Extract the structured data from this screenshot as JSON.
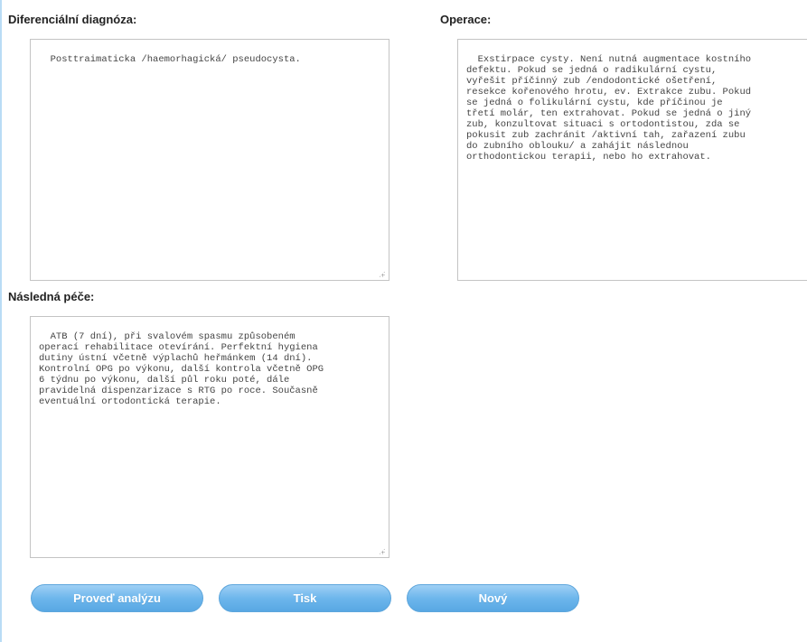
{
  "sections": {
    "differential_diagnosis": {
      "label": "Diferenciální diagnóza:",
      "value": "Posttraimaticka /haemorhagická/ pseudocysta."
    },
    "operation": {
      "label": "Operace:",
      "value": "Exstirpace cysty. Není nutná augmentace kostního\ndefektu. Pokud se jedná o radikulární cystu,\nvyřešit příčinný zub /endodontické ošetření,\nresekce kořenového hrotu, ev. Extrakce zubu. Pokud\nse jedná o folikulární cystu, kde příčinou je\ntřetí molár, ten extrahovat. Pokud se jedná o jiný\nzub, konzultovat situaci s ortodontistou, zda se\npokusit zub zachránit /aktivní tah, zařazení zubu\ndo zubního oblouku/ a zahájit následnou\northodontickou terapii, nebo ho extrahovat."
    },
    "follow_up_care": {
      "label": "Následná péče:",
      "value": "ATB (7 dní), při svalovém spasmu způsobeném\noperací rehabilitace otevírání. Perfektní hygiena\ndutiny ústní včetně výplachů heřmánkem (14 dní).\nKontrolní OPG po výkonu, další kontrola včetně OPG\n6 týdnu po výkonu, další půl roku poté, dále\npravidelná dispenzarizace s RTG po roce. Současně\neventuální ortodontická terapie."
    }
  },
  "buttons": {
    "analyze": "Proveď analýzu",
    "print": "Tisk",
    "new": "Nový"
  },
  "colors": {
    "button_top": "#9fd0f5",
    "button_bottom": "#58a8e3",
    "field_border": "#c4c4c4",
    "label_text": "#222222"
  }
}
